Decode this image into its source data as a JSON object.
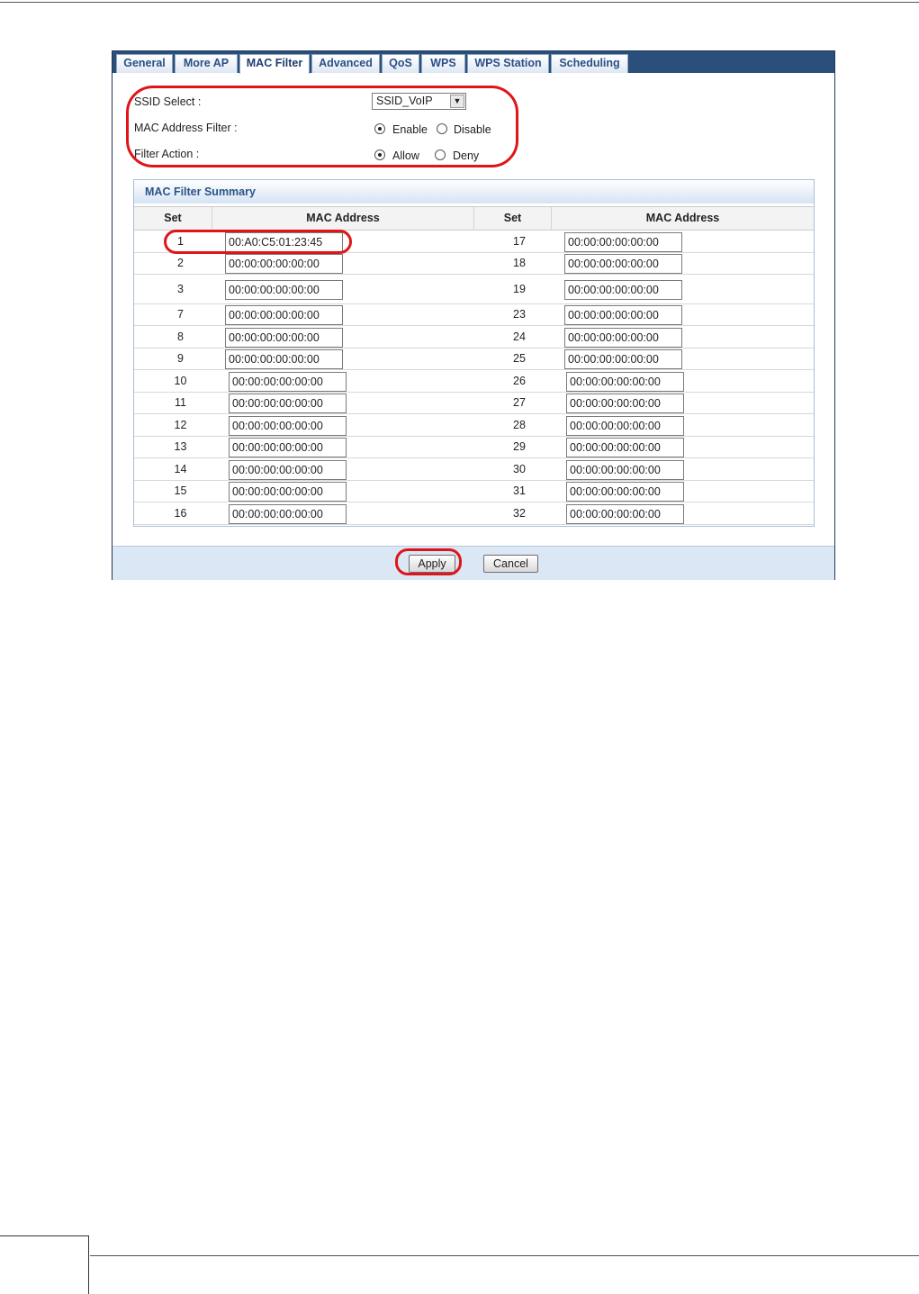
{
  "tabs": [
    "General",
    "More AP",
    "MAC Filter",
    "Advanced",
    "QoS",
    "WPS",
    "WPS Station",
    "Scheduling"
  ],
  "active_tab": "MAC Filter",
  "settings": {
    "ssid_label": "SSID Select :",
    "ssid_value": "SSID_VoIP",
    "mac_filter_label": "MAC Address Filter :",
    "enable_label": "Enable",
    "disable_label": "Disable",
    "mac_filter_state": "Enable",
    "filter_action_label": "Filter Action :",
    "allow_label": "Allow",
    "deny_label": "Deny",
    "filter_action_state": "Allow"
  },
  "summary": {
    "title": "MAC Filter Summary",
    "headers": [
      "Set",
      "MAC Address",
      "Set",
      "MAC Address"
    ],
    "rows": [
      {
        "l_set": "1",
        "l_mac": "00:A0:C5:01:23:45",
        "r_set": "17",
        "r_mac": "00:00:00:00:00:00"
      },
      {
        "l_set": "2",
        "l_mac": "00:00:00:00:00:00",
        "r_set": "18",
        "r_mac": "00:00:00:00:00:00"
      },
      {
        "l_set": "3",
        "l_mac": "00:00:00:00:00:00",
        "r_set": "19",
        "r_mac": "00:00:00:00:00:00"
      },
      {
        "l_set": "7",
        "l_mac": "00:00:00:00:00:00",
        "r_set": "23",
        "r_mac": "00:00:00:00:00:00"
      },
      {
        "l_set": "8",
        "l_mac": "00:00:00:00:00:00",
        "r_set": "24",
        "r_mac": "00:00:00:00:00:00"
      },
      {
        "l_set": "9",
        "l_mac": "00:00:00:00:00:00",
        "r_set": "25",
        "r_mac": "00:00:00:00:00:00"
      },
      {
        "l_set": "10",
        "l_mac": "00:00:00:00:00:00",
        "r_set": "26",
        "r_mac": "00:00:00:00:00:00"
      },
      {
        "l_set": "11",
        "l_mac": "00:00:00:00:00:00",
        "r_set": "27",
        "r_mac": "00:00:00:00:00:00"
      },
      {
        "l_set": "12",
        "l_mac": "00:00:00:00:00:00",
        "r_set": "28",
        "r_mac": "00:00:00:00:00:00"
      },
      {
        "l_set": "13",
        "l_mac": "00:00:00:00:00:00",
        "r_set": "29",
        "r_mac": "00:00:00:00:00:00"
      },
      {
        "l_set": "14",
        "l_mac": "00:00:00:00:00:00",
        "r_set": "30",
        "r_mac": "00:00:00:00:00:00"
      },
      {
        "l_set": "15",
        "l_mac": "00:00:00:00:00:00",
        "r_set": "31",
        "r_mac": "00:00:00:00:00:00"
      },
      {
        "l_set": "16",
        "l_mac": "00:00:00:00:00:00",
        "r_set": "32",
        "r_mac": "00:00:00:00:00:00"
      }
    ]
  },
  "buttons": {
    "apply": "Apply",
    "cancel": "Cancel"
  },
  "colors": {
    "tabbar": "#2a4f7a",
    "highlight": "#e0141b",
    "summary_title": "#2b5488"
  }
}
